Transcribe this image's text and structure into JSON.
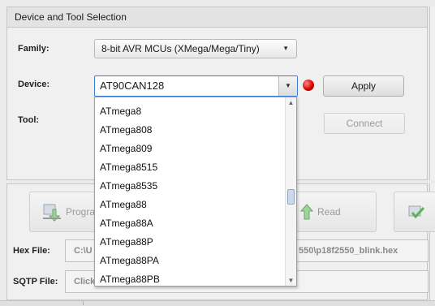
{
  "panel_title": "Device and Tool Selection",
  "family": {
    "label": "Family:",
    "value": "8-bit AVR MCUs (XMega/Mega/Tiny)"
  },
  "device": {
    "label": "Device:",
    "value": "AT90CAN128"
  },
  "tool": {
    "label": "Tool:"
  },
  "buttons": {
    "apply": "Apply",
    "connect": "Connect"
  },
  "actions": {
    "program": "Program",
    "read": "Read"
  },
  "hex_file": {
    "label": "Hex File:",
    "value": "C:\\U",
    "value_tail": "550\\p18f2550_blink.hex"
  },
  "sqtp_file": {
    "label": "SQTP File:",
    "value": "Click"
  },
  "device_options": [
    "ATmega8",
    "ATmega808",
    "ATmega809",
    "ATmega8515",
    "ATmega8535",
    "ATmega88",
    "ATmega88A",
    "ATmega88P",
    "ATmega88PA",
    "ATmega88PB"
  ],
  "colors": {
    "led": "#d90000",
    "focus": "#3a7bd5"
  }
}
